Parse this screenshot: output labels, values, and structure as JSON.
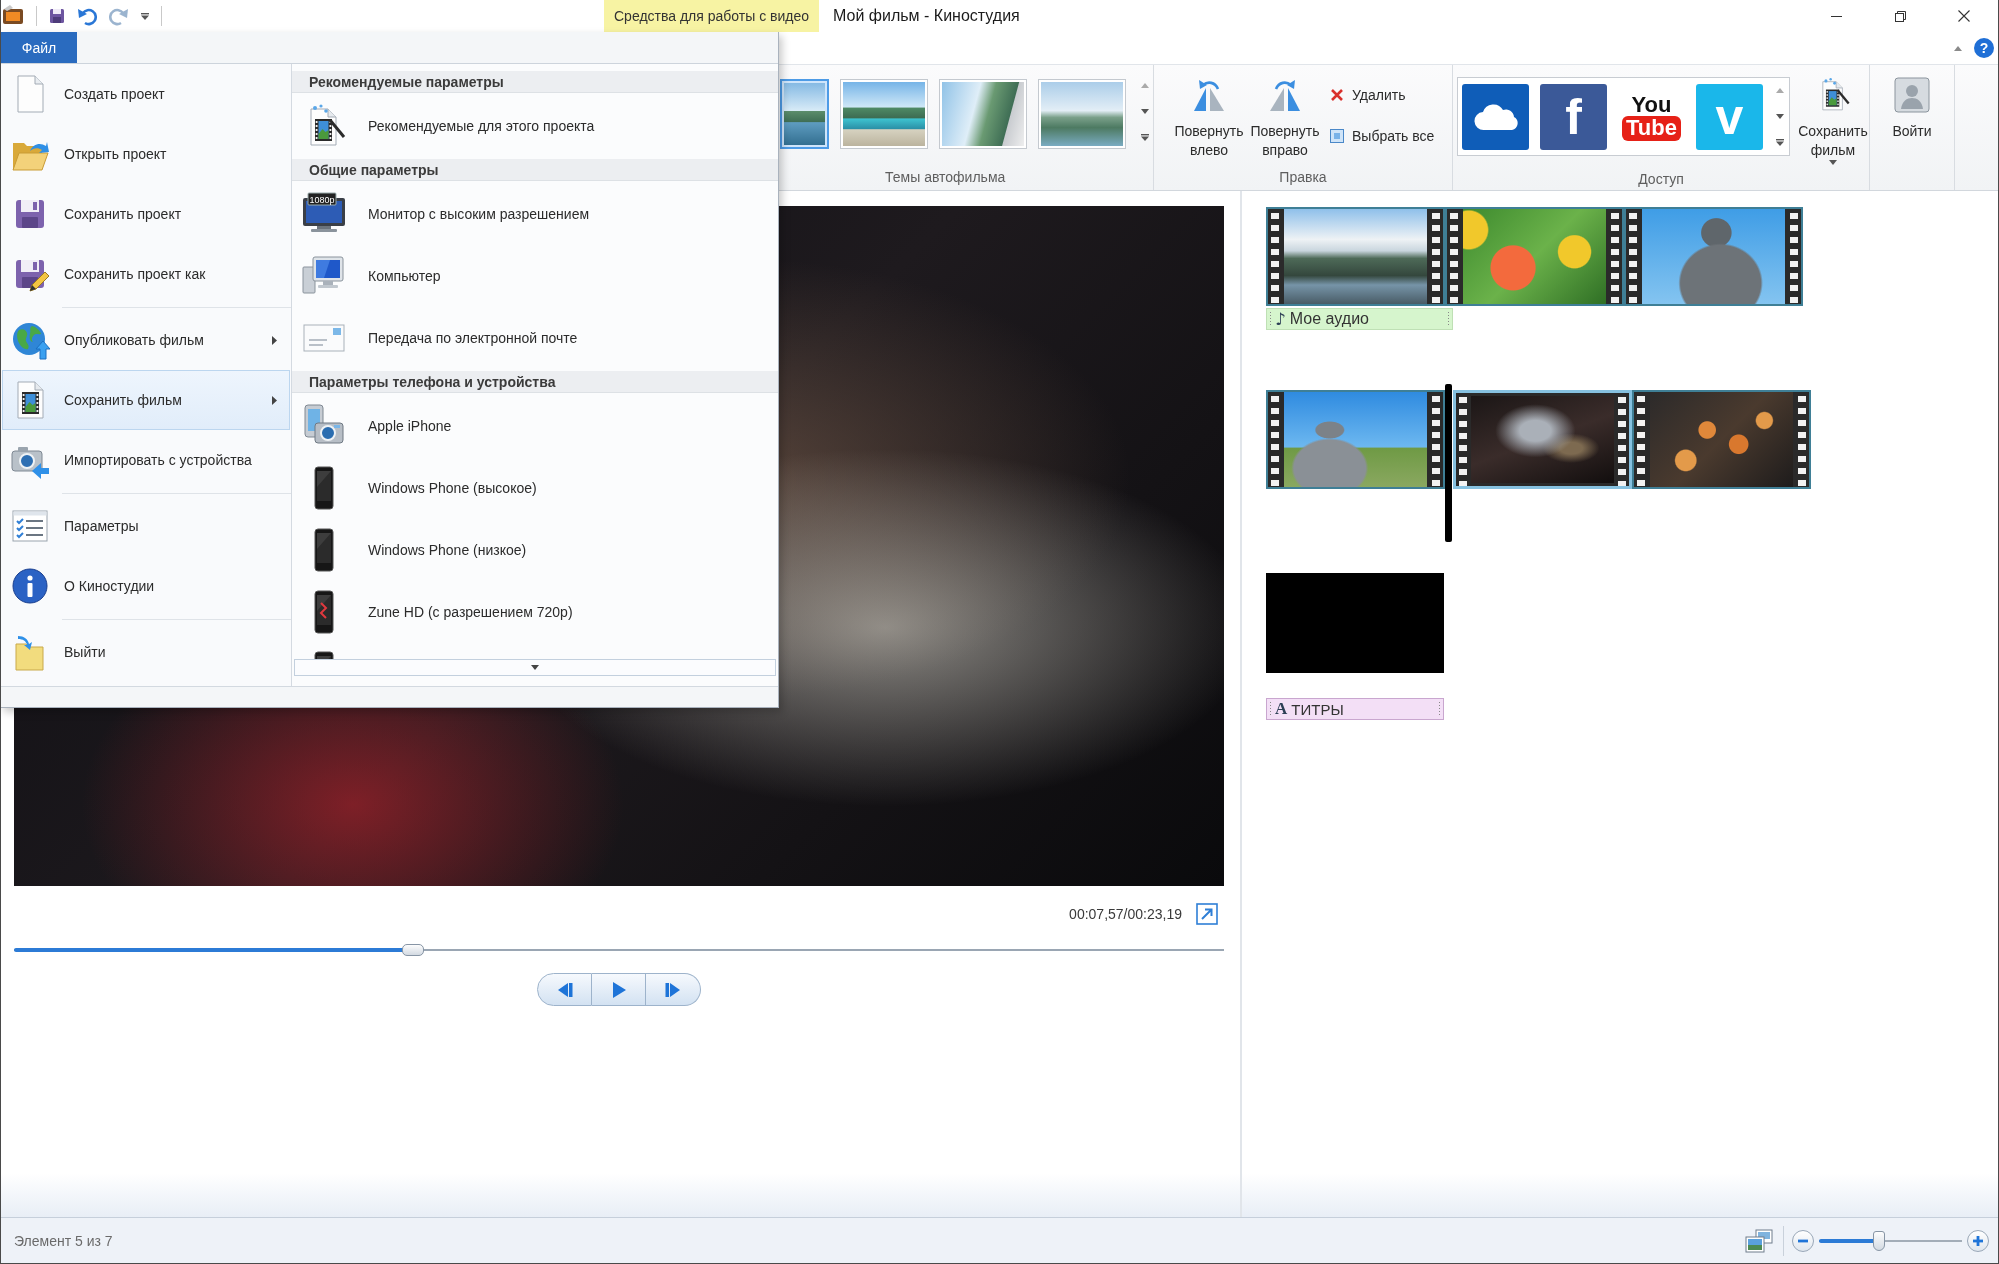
{
  "title_bar": {
    "context_tab": "Средства для работы с видео",
    "title": "Мой фильм - Киностудия"
  },
  "tab_row": {
    "help": "?"
  },
  "ribbon": {
    "themes": {
      "label": "Темы автофильма",
      "items": [
        {
          "selected": true
        },
        {
          "selected": false
        },
        {
          "selected": false
        },
        {
          "selected": false
        }
      ]
    },
    "edit": {
      "label": "Правка",
      "large_buttons": [
        {
          "label": "Повернуть влево"
        },
        {
          "label": "Повернуть вправо"
        }
      ],
      "small_buttons": [
        {
          "label": "Удалить"
        },
        {
          "label": "Выбрать все"
        }
      ]
    },
    "share": {
      "label": "Доступ",
      "services": [
        {
          "kind": "cloud",
          "color": "#0f5db8"
        },
        {
          "kind": "letter",
          "text": "f",
          "color": "#3b5998"
        },
        {
          "kind": "wordmark",
          "words": [
            "You",
            "Tube"
          ],
          "color": "#ffffff"
        },
        {
          "kind": "letter",
          "text": "v",
          "color": "#1ab7ea"
        }
      ],
      "save_movie": {
        "label": "Сохранить фильм"
      }
    },
    "sign_in": {
      "label": "Войти"
    }
  },
  "preview": {
    "time": "00:07,57/00:23,19",
    "seek": {
      "level": 0.33
    }
  },
  "storyboard": {
    "rows": [
      {
        "clips": [
          {
            "kind": "photo",
            "selected": false,
            "playhead": false
          },
          {
            "kind": "photo",
            "selected": false,
            "playhead": false
          },
          {
            "kind": "photo",
            "selected": false,
            "playhead": false
          }
        ],
        "caption": {
          "kind": "audio",
          "glyph": "♪",
          "label": "Мое аудио"
        }
      },
      {
        "clips": [
          {
            "kind": "photo",
            "selected": false,
            "playhead": false
          },
          {
            "kind": "photo",
            "selected": true,
            "playhead": true
          },
          {
            "kind": "photo",
            "selected": false,
            "playhead": false
          }
        ]
      },
      {
        "clips": [
          {
            "kind": "blank",
            "selected": false,
            "playhead": false
          }
        ],
        "caption": {
          "kind": "title",
          "glyph": "A",
          "label": "ТИТРЫ"
        }
      }
    ]
  },
  "status_bar": {
    "text": "Элемент 5 из 7",
    "zoom": {
      "level": 0.42
    }
  },
  "file_menu": {
    "tab": {
      "label": "Файл",
      "selected": true
    },
    "command_groups": [
      [
        {
          "label": "Создать проект",
          "submenu": false,
          "selected": false
        },
        {
          "label": "Открыть проект",
          "submenu": false,
          "selected": false
        },
        {
          "label": "Сохранить проект",
          "submenu": false,
          "selected": false
        },
        {
          "label": "Сохранить проект как",
          "submenu": false,
          "selected": false
        }
      ],
      [
        {
          "label": "Опубликовать фильм",
          "submenu": true,
          "selected": false
        },
        {
          "label": "Сохранить фильм",
          "submenu": true,
          "selected": true
        },
        {
          "label": "Импортировать с устройства",
          "submenu": false,
          "selected": false
        }
      ],
      [
        {
          "label": "Параметры",
          "submenu": false,
          "selected": false
        },
        {
          "label": "О Киностудии",
          "submenu": false,
          "selected": false
        }
      ],
      [
        {
          "label": "Выйти",
          "submenu": false,
          "selected": false
        }
      ]
    ],
    "save_movie_sections": [
      {
        "heading": "Рекомендуемые параметры",
        "items": [
          {
            "label": "Рекомендуемые для этого проекта",
            "partial": false
          }
        ]
      },
      {
        "heading": "Общие параметры",
        "items": [
          {
            "label": "Монитор с высоким разрешением",
            "icon_label": "1080p",
            "partial": false
          },
          {
            "label": "Компьютер",
            "partial": false
          },
          {
            "label": "Передача по электронной почте",
            "partial": false
          }
        ]
      },
      {
        "heading": "Параметры телефона и устройства",
        "items": [
          {
            "label": "Apple iPhone",
            "partial": false
          },
          {
            "label": "Windows Phone (высокое)",
            "partial": false
          },
          {
            "label": "Windows Phone (низкое)",
            "partial": false
          },
          {
            "label": "Zune HD (с разрешением 720p)",
            "partial": false
          },
          {
            "partial": true
          }
        ]
      }
    ]
  }
}
